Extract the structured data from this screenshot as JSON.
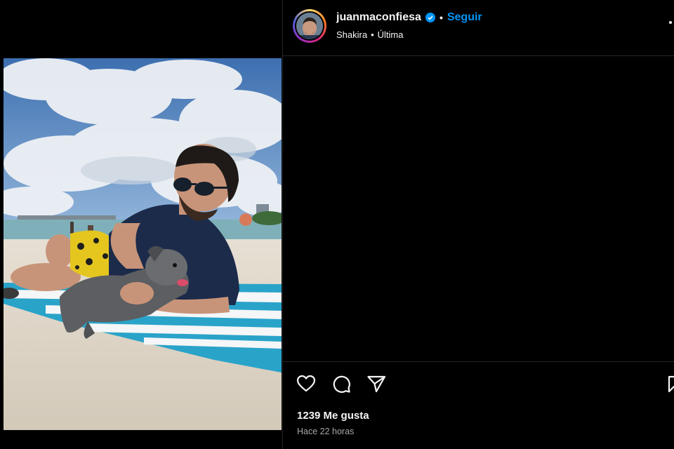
{
  "post": {
    "username": "juanmaconfiesa",
    "verified": true,
    "separator": "•",
    "follow_label": "Seguir",
    "audio_artist": "Shakira",
    "audio_separator": "•",
    "audio_track": "Última",
    "likes_text": "1239 Me gusta",
    "time_text": "Hace 22 horas"
  },
  "icons": {
    "like": "heart-icon",
    "comment": "comment-icon",
    "share": "share-icon",
    "save": "bookmark-icon",
    "more": "more-options-icon",
    "verified": "verified-badge-icon"
  },
  "colors": {
    "background": "#000000",
    "accent": "#0095f6",
    "text": "#f5f5f5",
    "muted": "#a8a8a8"
  }
}
